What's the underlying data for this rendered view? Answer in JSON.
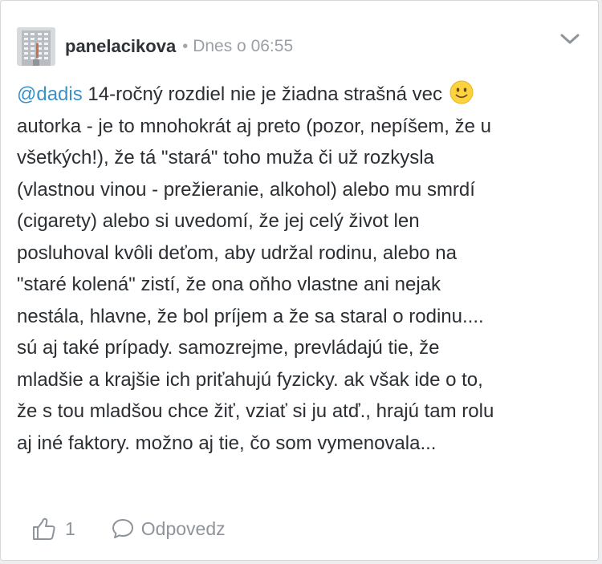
{
  "comment": {
    "author": "panelacikova",
    "separator": "•",
    "timestamp": "Dnes o 06:55",
    "mention": "@dadis",
    "text_before_emoji": " 14-ročný rozdiel nie je žiadna strašná vec ",
    "emoji": "slightly-smiling-face-icon",
    "text_after_emoji": "\nautorka - je to mnohokrát aj preto (pozor, nepíšem, že u\nvšetkých!), že tá \"stará\" toho muža či už rozkysla\n(vlastnou vinou - prežieranie, alkohol) alebo mu smrdí\n(cigarety) alebo si uvedomí, že jej celý život len\nposluhoval kvôli deťom, aby udržal rodinu, alebo na\n\"staré kolená\" zistí, že ona oňho vlastne ani nejak\nnestála, hlavne, že bol príjem a že sa staral o rodinu....\nsú aj také prípady. samozrejme, prevládajú tie, že\nmladšie a krajšie ich priťahujú fyzicky. ak však ide o to,\nže s tou mladšou chce žiť, vziať si ju atď., hrajú tam rolu\naj iné faktory. možno aj tie, čo som vymenovala..."
  },
  "actions": {
    "like_count": "1",
    "reply_label": "Odpovedz"
  },
  "icons": {
    "menu": "chevron-down-icon",
    "like": "thumbs-up-icon",
    "reply": "speech-bubble-icon"
  },
  "colors": {
    "mention": "#3a91c8",
    "author": "#2e3236",
    "muted": "#9aa0a6",
    "emoji_fill": "#fcd33f"
  }
}
